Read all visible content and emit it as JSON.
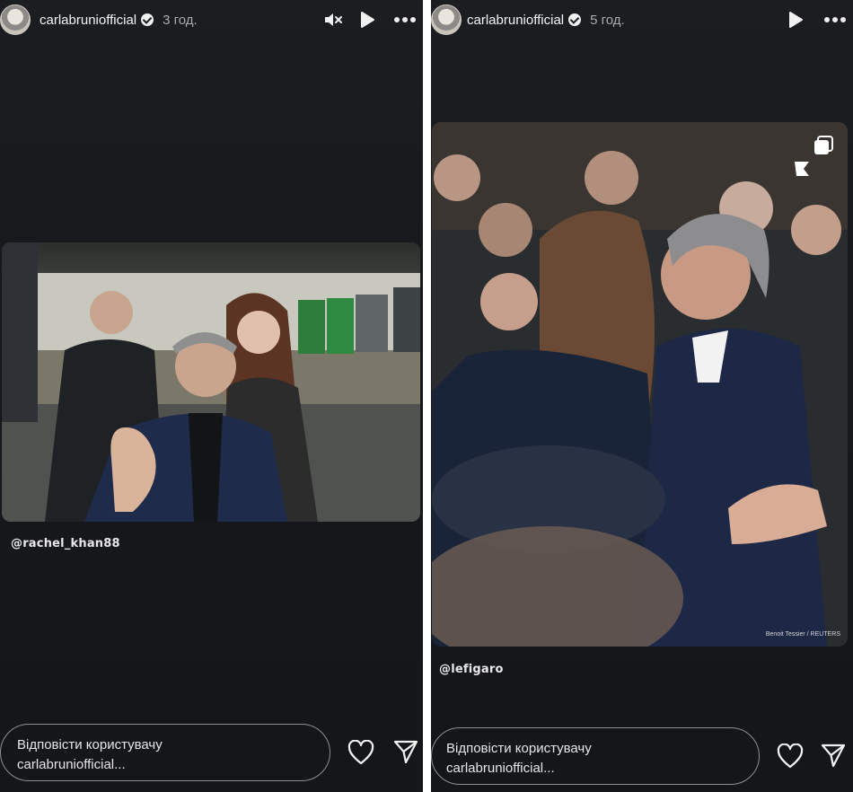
{
  "stories": [
    {
      "username": "carlabruniofficial",
      "timestamp": "3 год.",
      "header_icons": [
        "mute-icon",
        "play-icon",
        "more-icon"
      ],
      "mention": "@rachel_khan88",
      "reply_placeholder_line1": "Відповісти користувачу",
      "reply_placeholder_line2": "carlabruniofficial..."
    },
    {
      "username": "carlabruniofficial",
      "timestamp": "5 год.",
      "header_icons": [
        "play-icon",
        "more-icon"
      ],
      "mention": "@lefigaro",
      "photo_credit": "Benoit Tessier / REUTERS",
      "reply_placeholder_line1": "Відповісти користувачу",
      "reply_placeholder_line2": "carlabruniofficial..."
    }
  ],
  "colors": {
    "background": "#16181c",
    "text": "#f5f5f5",
    "muted": "#a9abaf",
    "border": "#8d8f93"
  }
}
